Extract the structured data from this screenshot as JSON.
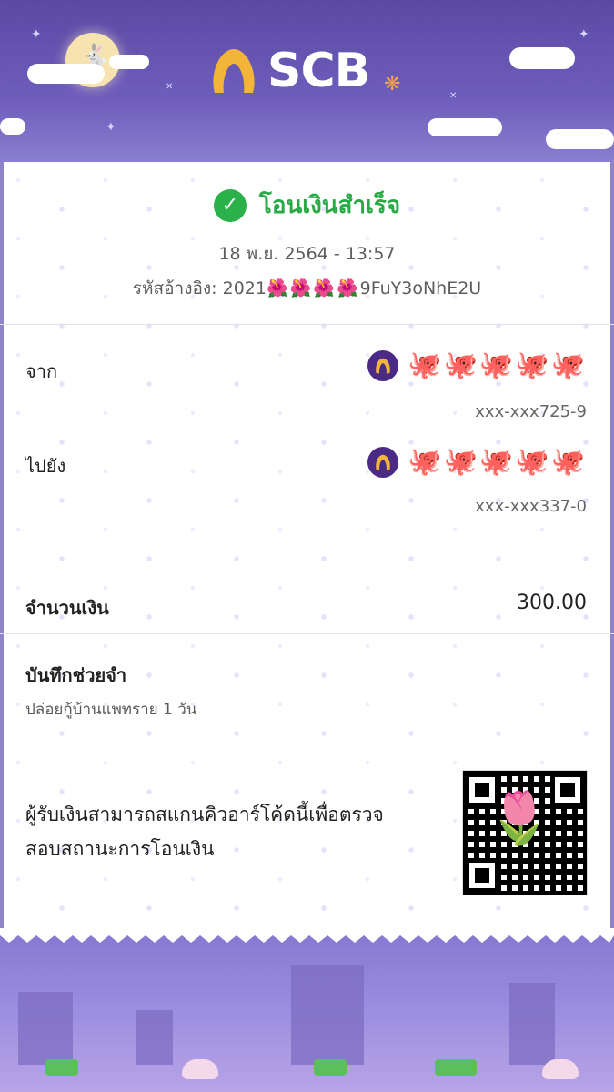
{
  "brand": {
    "name": "SCB"
  },
  "status": {
    "text": "โอนเงินสำเร็จ"
  },
  "datetime": "18 พ.ย. 2564 - 13:57",
  "reference": {
    "label": "รหัสอ้างอิง:",
    "visible_prefix": "2021",
    "masked": "🌺🌺🌺🌺",
    "visible_suffix": "9FuY3oNhE2U"
  },
  "from": {
    "label": "จาก",
    "masked_name": "🐙🐙🐙🐙🐙",
    "account": "xxx-xxx725-9"
  },
  "to": {
    "label": "ไปยัง",
    "masked_name": "🐙🐙🐙🐙🐙",
    "account": "xxx-xxx337-0"
  },
  "amount": {
    "label": "จำนวนเงิน",
    "value": "300.00"
  },
  "memo": {
    "label": "บันทึกช่วยจำ",
    "value": "ปล่อยกู้บ้านแพทราย 1 วัน"
  },
  "qr": {
    "text": "ผู้รับเงินสามารถสแกนคิวอาร์โค้ดนี้เพื่อตรวจสอบสถานะการโอนเงิน"
  },
  "icons": [
    "check-icon",
    "bank-icon",
    "qr-code",
    "tulip-icon"
  ]
}
